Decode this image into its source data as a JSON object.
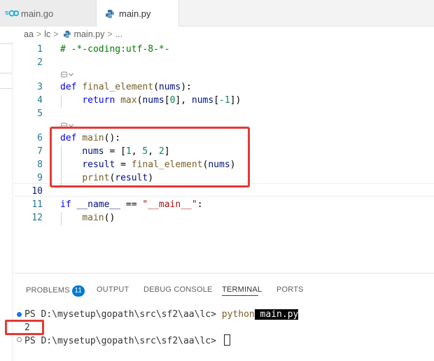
{
  "tabs": [
    {
      "label": "main.go",
      "icon": "go-icon",
      "active": false
    },
    {
      "label": "main.py",
      "icon": "python-icon",
      "active": true
    }
  ],
  "breadcrumb": {
    "items": [
      "aa",
      "lc",
      "main.py",
      "..."
    ]
  },
  "editor": {
    "lines": [
      {
        "num": "1",
        "text": "# -*-coding:utf-8-*-"
      },
      {
        "num": "2",
        "text": ""
      },
      {
        "num": "3",
        "text": "def final_element(nums):"
      },
      {
        "num": "4",
        "text": "    return max(nums[0], nums[-1])"
      },
      {
        "num": "5",
        "text": ""
      },
      {
        "num": "6",
        "text": "def main():"
      },
      {
        "num": "7",
        "text": "    nums = [1, 5, 2]"
      },
      {
        "num": "8",
        "text": "    result = final_element(nums)"
      },
      {
        "num": "9",
        "text": "    print(result)"
      },
      {
        "num": "10",
        "text": ""
      },
      {
        "num": "11",
        "text": "if __name__ == \"__main__\":"
      },
      {
        "num": "12",
        "text": "    main()"
      }
    ],
    "codelens_icon": "copilot-icon",
    "codelens_chevron": "chevron-down-icon",
    "highlight_color": "#e53935"
  },
  "panel": {
    "tabs": [
      "PROBLEMS",
      "OUTPUT",
      "DEBUG CONSOLE",
      "TERMINAL",
      "PORTS"
    ],
    "problems_count": "11",
    "active_tab": "TERMINAL",
    "accent": "#007acc"
  },
  "terminal": {
    "prompt1": "PS D:\\mysetup\\gopath\\src\\sf2\\aa\\lc> ",
    "cmd": "python",
    "arg": " main.py",
    "output": "2",
    "prompt2": "PS D:\\mysetup\\gopath\\src\\sf2\\aa\\lc> "
  }
}
